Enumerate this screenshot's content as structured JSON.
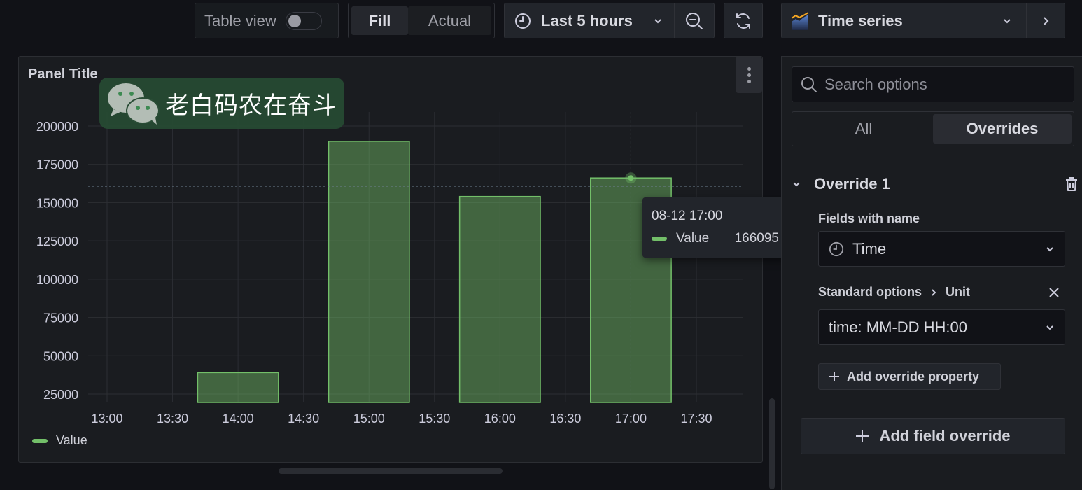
{
  "toolbar": {
    "table_view_label": "Table view",
    "table_view_on": false,
    "fill_label": "Fill",
    "actual_label": "Actual",
    "selected_mode": "Fill",
    "time_range_label": "Last 5 hours",
    "icons": {
      "clock": "clock-icon",
      "chevron": "chevron-down-icon",
      "zoom_out": "zoom-out-icon",
      "refresh": "refresh-icon",
      "viz": "time-series-viz-icon",
      "next": "chevron-right-icon"
    },
    "visualization_label": "Time series"
  },
  "panel": {
    "title": "Panel Title",
    "watermark_text": "老白码农在奋斗",
    "tooltip": {
      "time": "08-12 17:00",
      "series_name": "Value",
      "value": "166095"
    },
    "legend": [
      {
        "label": "Value",
        "color": "#73bf69"
      }
    ]
  },
  "chart_data": {
    "type": "bar",
    "title": "Panel Title",
    "xlabel": "",
    "ylabel": "",
    "x_ticks": [
      "13:00",
      "13:30",
      "14:00",
      "14:30",
      "15:00",
      "15:30",
      "16:00",
      "16:30",
      "17:00",
      "17:30"
    ],
    "y_ticks": [
      25000,
      50000,
      75000,
      100000,
      125000,
      150000,
      175000,
      200000
    ],
    "ylim": [
      18000,
      210000
    ],
    "x_range": [
      "12:58",
      "17:50"
    ],
    "grid": true,
    "legend_position": "bottom-left",
    "series": [
      {
        "name": "Value",
        "color": "#73bf69",
        "points": [
          {
            "x": "14:00",
            "y": 39000
          },
          {
            "x": "15:00",
            "y": 190000
          },
          {
            "x": "16:00",
            "y": 154000
          },
          {
            "x": "17:00",
            "y": 166095
          }
        ]
      }
    ],
    "crosshair": {
      "x": "17:00",
      "y": 160700
    },
    "hover_point": {
      "x": "17:00",
      "y": 166095
    }
  },
  "options": {
    "search_placeholder": "Search options",
    "tabs": [
      {
        "label": "All",
        "active": false
      },
      {
        "label": "Overrides",
        "active": true
      }
    ],
    "override": {
      "title": "Override 1",
      "matcher_label": "Fields with name",
      "matcher_value": "Time",
      "property_path": [
        "Standard options",
        "Unit"
      ],
      "property_value": "time: MM-DD HH:00",
      "add_property_label": "Add override property"
    },
    "add_field_override_label": "Add field override"
  },
  "colors": {
    "series": "#73bf69",
    "bar_fill": "#3f5a3f",
    "background": "#111217",
    "panel": "#1a1c20"
  }
}
